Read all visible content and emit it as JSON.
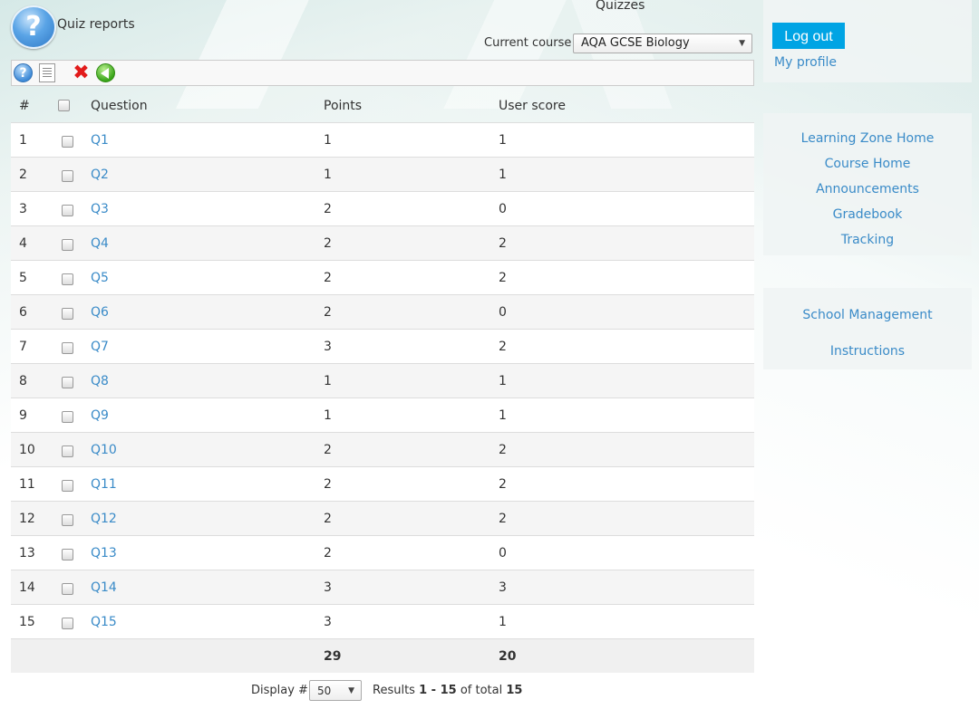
{
  "header": {
    "title": "Quiz reports",
    "tool_name": "Quizzes",
    "course_label": "Current course",
    "course_value": "AQA GCSE Biology"
  },
  "table": {
    "headers": [
      "#",
      "Question",
      "Points",
      "User score"
    ],
    "rows": [
      {
        "num": "1",
        "question": "Q1",
        "points": "1",
        "score": "1"
      },
      {
        "num": "2",
        "question": "Q2",
        "points": "1",
        "score": "1"
      },
      {
        "num": "3",
        "question": "Q3",
        "points": "2",
        "score": "0"
      },
      {
        "num": "4",
        "question": "Q4",
        "points": "2",
        "score": "2"
      },
      {
        "num": "5",
        "question": "Q5",
        "points": "2",
        "score": "2"
      },
      {
        "num": "6",
        "question": "Q6",
        "points": "2",
        "score": "0"
      },
      {
        "num": "7",
        "question": "Q7",
        "points": "3",
        "score": "2"
      },
      {
        "num": "8",
        "question": "Q8",
        "points": "1",
        "score": "1"
      },
      {
        "num": "9",
        "question": "Q9",
        "points": "1",
        "score": "1"
      },
      {
        "num": "10",
        "question": "Q10",
        "points": "2",
        "score": "2"
      },
      {
        "num": "11",
        "question": "Q11",
        "points": "2",
        "score": "2"
      },
      {
        "num": "12",
        "question": "Q12",
        "points": "2",
        "score": "2"
      },
      {
        "num": "13",
        "question": "Q13",
        "points": "2",
        "score": "0"
      },
      {
        "num": "14",
        "question": "Q14",
        "points": "3",
        "score": "3"
      },
      {
        "num": "15",
        "question": "Q15",
        "points": "3",
        "score": "1"
      }
    ],
    "total_points": "29",
    "total_score": "20"
  },
  "pager": {
    "display_label": "Display #",
    "display_value": "50",
    "results_prefix": "Results",
    "range": "1 - 15",
    "of_total": "of total",
    "total": "15"
  },
  "sidebar": {
    "logout_label": "Log out",
    "profile_label": "My profile",
    "nav": [
      "Learning Zone Home",
      "Course Home",
      "Announcements",
      "Gradebook",
      "Tracking"
    ],
    "admin": [
      "School Management",
      "Instructions"
    ]
  },
  "colors": {
    "link": "#3a8bc8",
    "logout_bg": "#00a4e4",
    "delete_icon": "#e21b1b",
    "back_icon": "#3aa51a"
  }
}
